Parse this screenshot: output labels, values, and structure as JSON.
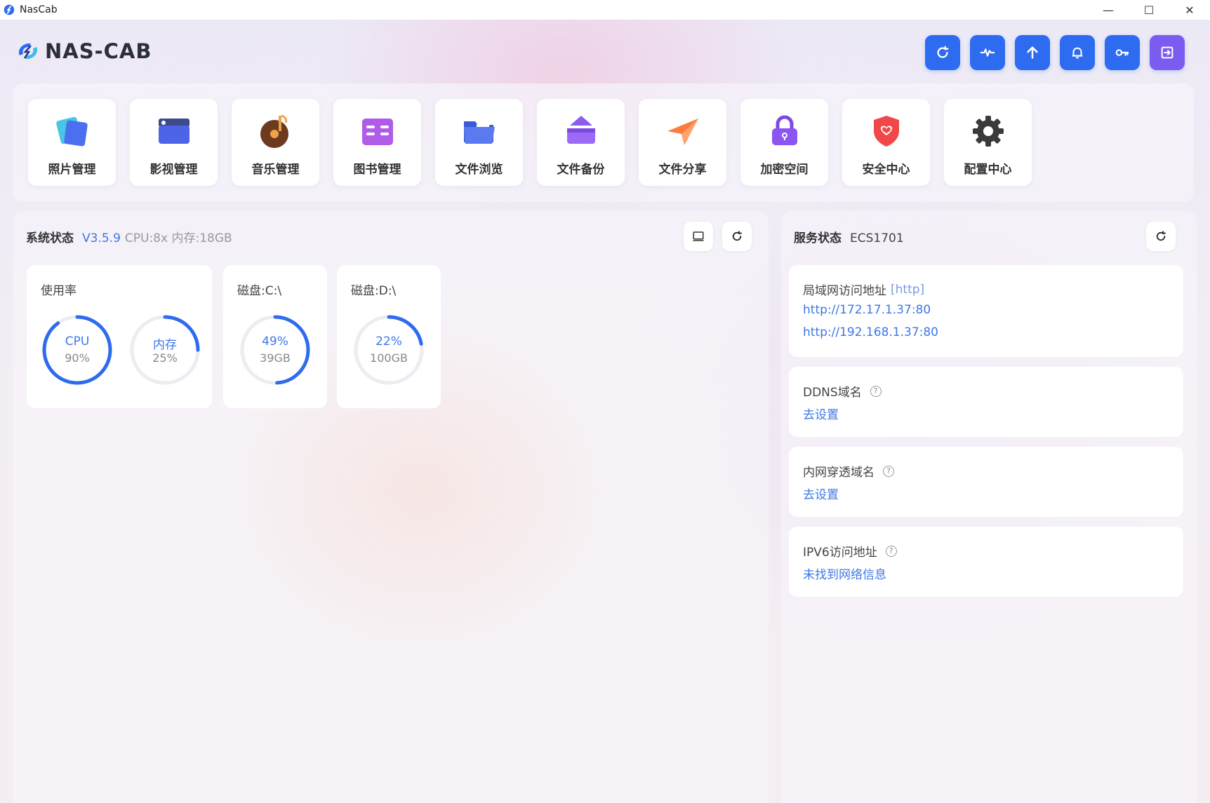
{
  "window": {
    "title": "NasCab",
    "controls": {
      "minimize": "—",
      "maximize": "☐",
      "close": "✕"
    }
  },
  "header": {
    "logo_text": "NAS-CAB",
    "toolbar": [
      {
        "name": "refresh-button",
        "icon": "refresh-icon"
      },
      {
        "name": "activity-button",
        "icon": "pulse-icon"
      },
      {
        "name": "upload-button",
        "icon": "arrow-up-icon"
      },
      {
        "name": "notification-button",
        "icon": "bell-icon"
      },
      {
        "name": "key-button",
        "icon": "key-icon"
      },
      {
        "name": "logout-button",
        "icon": "logout-icon",
        "color": "#7b5cf0"
      }
    ],
    "accent": "#2d6bf0"
  },
  "apps": [
    {
      "label": "照片管理",
      "icon": "photos-icon"
    },
    {
      "label": "影视管理",
      "icon": "movie-icon"
    },
    {
      "label": "音乐管理",
      "icon": "music-icon"
    },
    {
      "label": "图书管理",
      "icon": "book-icon"
    },
    {
      "label": "文件浏览",
      "icon": "folder-icon"
    },
    {
      "label": "文件备份",
      "icon": "backup-icon"
    },
    {
      "label": "文件分享",
      "icon": "share-icon"
    },
    {
      "label": "加密空间",
      "icon": "lock-icon"
    },
    {
      "label": "安全中心",
      "icon": "shield-icon"
    },
    {
      "label": "配置中心",
      "icon": "gear-icon"
    }
  ],
  "system": {
    "title": "系统状态",
    "version": "V3.5.9",
    "meta": "CPU:8x 内存:18GB",
    "usage_card": {
      "title": "使用率",
      "cpu": {
        "label": "CPU",
        "value": "90%",
        "percent": 90
      },
      "mem": {
        "label": "内存",
        "value": "25%",
        "percent": 25
      }
    },
    "disks": [
      {
        "title": "磁盘:C:\\",
        "label": "49%",
        "value": "39GB",
        "percent": 49
      },
      {
        "title": "磁盘:D:\\",
        "label": "22%",
        "value": "100GB",
        "percent": 22
      }
    ]
  },
  "service": {
    "title": "服务状态",
    "host": "ECS1701",
    "lan": {
      "title": "局域网访问地址",
      "tag": "[http]",
      "urls": [
        "http://172.17.1.37:80",
        "http://192.168.1.37:80"
      ]
    },
    "ddns": {
      "title": "DDNS域名",
      "action": "去设置"
    },
    "tunnel": {
      "title": "内网穿透域名",
      "action": "去设置"
    },
    "ipv6": {
      "title": "IPV6访问地址",
      "action": "未找到网络信息"
    },
    "help_glyph": "?"
  }
}
